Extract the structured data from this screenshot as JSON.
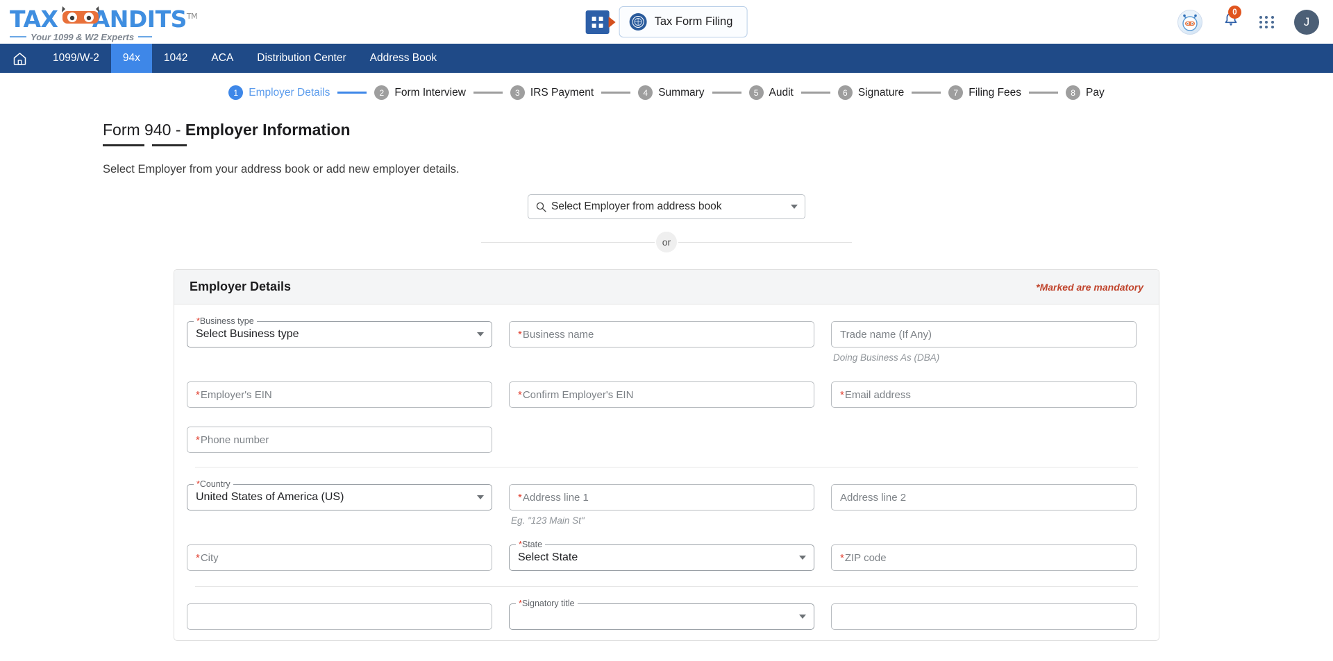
{
  "brand": {
    "name_part1": "TAX",
    "name_part2": "ANDITS",
    "tm": "TM",
    "tagline": "Your 1099 & W2 Experts"
  },
  "header": {
    "apps_launcher_icon": "apps-grid-icon",
    "filing_button_label": "Tax Form Filing",
    "filing_button_icon": "irs-seal-icon",
    "bot_icon": "bot-mascot-icon",
    "bell_icon": "bell-icon",
    "notification_count": "0",
    "grid_icon": "dots-grid-icon",
    "user_initial": "J"
  },
  "nav": {
    "home_icon": "home-icon",
    "items": [
      {
        "label": "1099/W-2",
        "active": false
      },
      {
        "label": "94x",
        "active": true
      },
      {
        "label": "1042",
        "active": false
      },
      {
        "label": "ACA",
        "active": false
      },
      {
        "label": "Distribution Center",
        "active": false
      },
      {
        "label": "Address Book",
        "active": false
      }
    ]
  },
  "stepper": {
    "steps": [
      {
        "num": "1",
        "label": "Employer Details",
        "active": true
      },
      {
        "num": "2",
        "label": "Form Interview",
        "active": false
      },
      {
        "num": "3",
        "label": "IRS Payment",
        "active": false
      },
      {
        "num": "4",
        "label": "Summary",
        "active": false
      },
      {
        "num": "5",
        "label": "Audit",
        "active": false
      },
      {
        "num": "6",
        "label": "Signature",
        "active": false
      },
      {
        "num": "7",
        "label": "Filing Fees",
        "active": false
      },
      {
        "num": "8",
        "label": "Pay",
        "active": false
      }
    ]
  },
  "page": {
    "title_prefix": "Form 940 - ",
    "title_strong": "Employer Information",
    "subtitle": "Select Employer from your address book or add new employer details.",
    "employer_search_placeholder": "Select Employer from address book",
    "search_icon": "search-icon",
    "or_label": "or"
  },
  "card": {
    "title": "Employer Details",
    "mandatory_note": "*Marked are mandatory",
    "fields": {
      "business_type": {
        "legend_ast": "*",
        "legend": "Business type",
        "value": "Select Business type"
      },
      "business_name": {
        "ast": "*",
        "placeholder": "Business name"
      },
      "trade_name": {
        "ast": "",
        "placeholder": "Trade name (If Any)",
        "helper": "Doing Business As (DBA)"
      },
      "employer_ein": {
        "ast": "*",
        "placeholder": "Employer's EIN"
      },
      "confirm_ein": {
        "ast": "*",
        "placeholder": "Confirm Employer's EIN"
      },
      "email": {
        "ast": "*",
        "placeholder": "Email address"
      },
      "phone": {
        "ast": "*",
        "placeholder": "Phone number"
      },
      "country": {
        "legend_ast": "*",
        "legend": "Country",
        "value": "United States of America (US)"
      },
      "address1": {
        "ast": "*",
        "placeholder": "Address line 1",
        "helper": "Eg. \"123 Main St\""
      },
      "address2": {
        "ast": "",
        "placeholder": "Address line 2"
      },
      "city": {
        "ast": "*",
        "placeholder": " City"
      },
      "state": {
        "legend_ast": "*",
        "legend": "State",
        "value": "Select State"
      },
      "zip": {
        "ast": "*",
        "placeholder": "ZIP code"
      },
      "signatory_title": {
        "legend_ast": "*",
        "legend": "Signatory title",
        "value": ""
      }
    }
  },
  "colors": {
    "nav_bg": "#1f4a87",
    "nav_active": "#3e87e8",
    "accent_blue": "#3e87e8",
    "required_red": "#e03a2a",
    "mandatory_note": "#c0442c",
    "brand_blue": "#3f8ee0",
    "brand_orange": "#e0551f"
  }
}
